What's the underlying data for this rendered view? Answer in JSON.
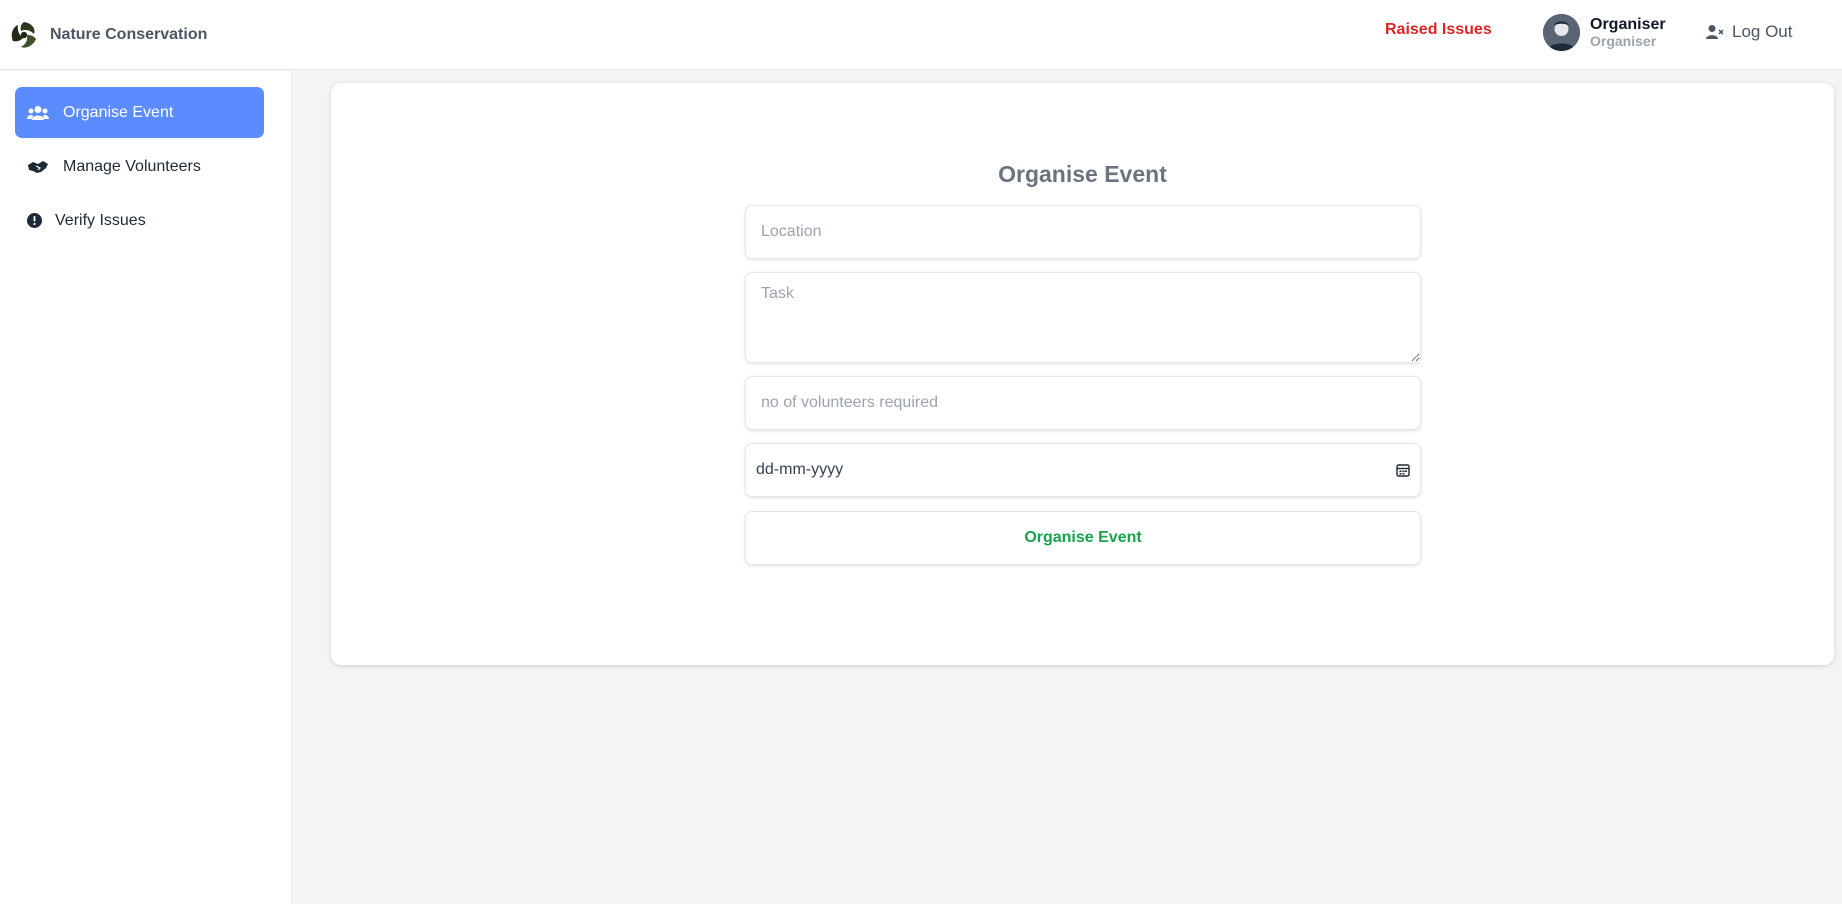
{
  "header": {
    "brand_name": "Nature Conservation",
    "raised_issues": "Raised Issues",
    "user_name": "Organiser",
    "user_role": "Organiser",
    "logout_label": "Log Out"
  },
  "sidebar": {
    "items": [
      {
        "label": "Organise Event",
        "icon": "users-icon",
        "active": true
      },
      {
        "label": "Manage Volunteers",
        "icon": "handshake-icon",
        "active": false
      },
      {
        "label": "Verify Issues",
        "icon": "exclamation-circle-icon",
        "active": false
      }
    ]
  },
  "form": {
    "title": "Organise Event",
    "location_placeholder": "Location",
    "task_placeholder": "Task",
    "volunteers_placeholder": "no of volunteers required",
    "date_placeholder": "dd-mm-yyyy",
    "submit_label": "Organise Event"
  },
  "colors": {
    "accent": "#5b8cff",
    "danger": "#dc2626",
    "success": "#16a34a"
  }
}
